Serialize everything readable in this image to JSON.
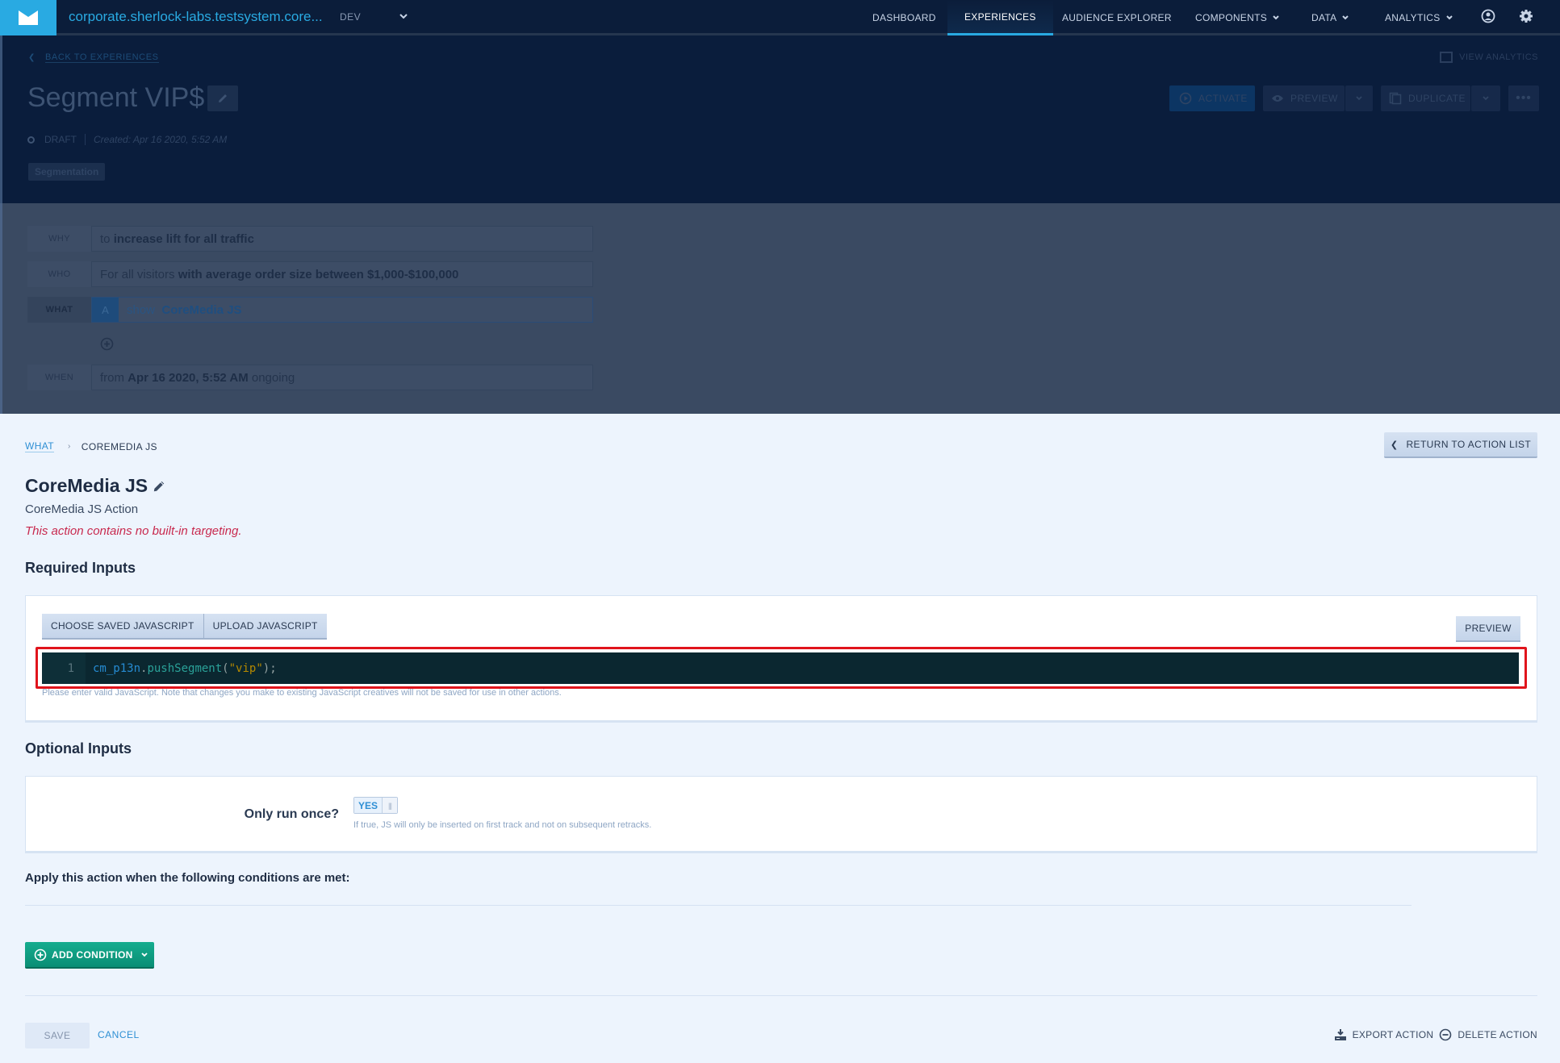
{
  "topnav": {
    "site_name": "corporate.sherlock-labs.testsystem.core...",
    "environment": "DEV",
    "items": [
      {
        "label": "DASHBOARD",
        "active": false,
        "has_caret": false
      },
      {
        "label": "EXPERIENCES",
        "active": true,
        "has_caret": false
      },
      {
        "label": "AUDIENCE EXPLORER",
        "active": false,
        "has_caret": false
      },
      {
        "label": "COMPONENTS",
        "active": false,
        "has_caret": true
      },
      {
        "label": "DATA",
        "active": false,
        "has_caret": true
      },
      {
        "label": "ANALYTICS",
        "active": false,
        "has_caret": true
      }
    ],
    "icons": [
      "user-icon",
      "gear-icon"
    ]
  },
  "experience": {
    "back_label": "BACK TO EXPERIENCES",
    "title": "Segment VIP$",
    "status": "DRAFT",
    "created": "Created: Apr 16 2020, 5:52 AM",
    "tag": "Segmentation",
    "view_analytics_label": "VIEW ANALYTICS",
    "buttons": {
      "activate": "ACTIVATE",
      "preview": "PREVIEW",
      "duplicate": "DUPLICATE",
      "more": "•••"
    }
  },
  "statement": {
    "why": {
      "label": "WHY",
      "prefix": "to ",
      "value": "increase lift for all traffic"
    },
    "who": {
      "label": "WHO",
      "prefix": "For all visitors ",
      "value": "with average order size between $1,000-$100,000"
    },
    "what": {
      "label": "WHAT",
      "badge": "A",
      "prefix": "show ",
      "value": "CoreMedia JS"
    },
    "when": {
      "label": "WHEN",
      "prefix": "from ",
      "value": "Apr 16 2020, 5:52 AM",
      "suffix": " ongoing"
    }
  },
  "action": {
    "breadcrumb": {
      "parent": "WHAT",
      "current": "COREMEDIA JS"
    },
    "return_label": "RETURN TO ACTION LIST",
    "title": "CoreMedia JS",
    "subtitle": "CoreMedia JS Action",
    "warning": "This action contains no built-in targeting.",
    "required_heading": "Required Inputs",
    "required": {
      "choose_saved_label": "CHOOSE SAVED JAVASCRIPT",
      "upload_label": "UPLOAD JAVASCRIPT",
      "preview_label": "PREVIEW",
      "code": {
        "line_number": "1",
        "object": "cm_p13n",
        "dot": ".",
        "method": "pushSegment",
        "open": "(",
        "string": "\"vip\"",
        "close": ");"
      },
      "hint": "Please enter valid JavaScript. Note that changes you make to existing JavaScript creatives will not be saved for use in other actions."
    },
    "optional_heading": "Optional Inputs",
    "optional": {
      "run_once_label": "Only run once?",
      "run_once_value": "YES",
      "run_once_enabled": true,
      "run_once_help": "If true, JS will only be inserted on first track and not on subsequent retracks."
    },
    "conditions_label": "Apply this action when the following conditions are met:",
    "add_condition_label": "ADD CONDITION",
    "save_label": "SAVE",
    "cancel_label": "CANCEL",
    "export_label": "EXPORT ACTION",
    "delete_label": "DELETE ACTION"
  },
  "colors": {
    "brand": "#29aae2",
    "nav_bg": "#0b1d3a",
    "add_condition": "#0f9e82",
    "warning": "#c8294e",
    "annotation": "#e0141c"
  }
}
